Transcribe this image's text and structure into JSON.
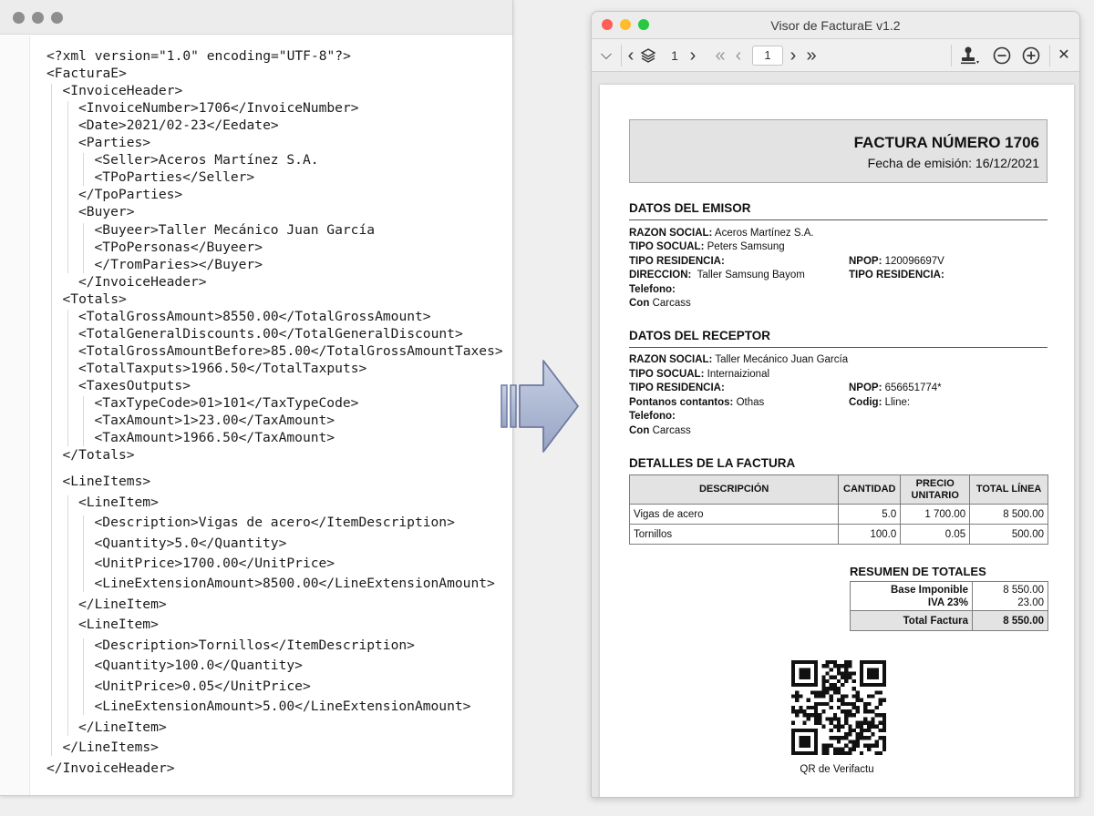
{
  "editor": {
    "lines": [
      {
        "text": "<?xml version=\"1.0\" encoding=\"UTF-8\"?>",
        "indent": 0
      },
      {
        "text": "<FacturaE>",
        "indent": 0
      },
      {
        "text": "<InvoiceHeader>",
        "indent": 1
      },
      {
        "text": "<InvoiceNumber>1706</InvoiceNumber>",
        "indent": 2
      },
      {
        "text": "<Date>2021/02-23</Eedate>",
        "indent": 2
      },
      {
        "text": "<Parties>",
        "indent": 2
      },
      {
        "text": "<Seller>Aceros Martínez S.A.",
        "indent": 3
      },
      {
        "text": "<TPoParties</Seller>",
        "indent": 3
      },
      {
        "text": "</TpoParties>",
        "indent": 2
      },
      {
        "text": "<Buyer>",
        "indent": 2
      },
      {
        "text": "<Buyeer>Taller Mecánico Juan García",
        "indent": 3
      },
      {
        "text": "<TPoPersonas</Buyeer>",
        "indent": 3
      },
      {
        "text": "</TromParies></Buyer>",
        "indent": 3
      },
      {
        "text": "</InvoiceHeader>",
        "indent": 2
      },
      {
        "text": "<Totals>",
        "indent": 1
      },
      {
        "text": "<TotalGrossAmount>8550.00</TotalGrossAmount>",
        "indent": 2
      },
      {
        "text": "<TotalGeneralDiscounts.00</TotalGeneralDiscount>",
        "indent": 2
      },
      {
        "text": "<TotalGrossAmountBefore>85.00</TotalGrossAmountTaxes>",
        "indent": 2
      },
      {
        "text": "<TotalTaxputs>1966.50</TotalTaxputs>",
        "indent": 2
      },
      {
        "text": "<TaxesOutputs>",
        "indent": 2
      },
      {
        "text": "<TaxTypeCode>01>101</TaxTypeCode>",
        "indent": 3
      },
      {
        "text": "<TaxAmount>1>23.00</TaxAmount>",
        "indent": 3
      },
      {
        "text": "<TaxAmount>1966.50</TaxAmount>",
        "indent": 3
      },
      {
        "text": "</Totals>",
        "indent": 1
      },
      {
        "text": "<LineItems>",
        "indent": 1
      },
      {
        "text": "<LineItem>",
        "indent": 2
      },
      {
        "text": "<Description>Vigas de acero</ItemDescription>",
        "indent": 3
      },
      {
        "text": "<Quantity>5.0</Quantity>",
        "indent": 3
      },
      {
        "text": "<UnitPrice>1700.00</UnitPrice>",
        "indent": 3
      },
      {
        "text": "<LineExtensionAmount>8500.00</LineExtensionAmount>",
        "indent": 3
      },
      {
        "text": "</LineItem>",
        "indent": 2
      },
      {
        "text": "<LineItem>",
        "indent": 2
      },
      {
        "text": "<Description>Tornillos</ItemDescription>",
        "indent": 3
      },
      {
        "text": "<Quantity>100.0</Quantity>",
        "indent": 3
      },
      {
        "text": "<UnitPrice>0.05</UnitPrice>",
        "indent": 3
      },
      {
        "text": "<LineExtensionAmount>5.00</LineExtensionAmount>",
        "indent": 3
      },
      {
        "text": "</LineItem>",
        "indent": 2
      },
      {
        "text": "</LineItems>",
        "indent": 1
      },
      {
        "text": "</InvoiceHeader>",
        "indent": 0
      }
    ]
  },
  "viewer": {
    "title": "Visor de FacturaE v1.2",
    "toolbar": {
      "chevron_down": "⌵",
      "prev": "‹",
      "next": "›",
      "layer_count": "1",
      "first": "«",
      "prev_page": "‹",
      "page_input": "1",
      "next_page": "›",
      "last": "»",
      "close": "✕"
    }
  },
  "invoice": {
    "title": "FACTURA NÚMERO 1706",
    "issue_date": "Fecha de emisión: 16/12/2021",
    "emisor": {
      "heading": "DATOS DEL EMISOR",
      "razon_label": "RAZON SOCIAL:",
      "razon_value": "Aceros Martínez S.A.",
      "tipo_social_label": "TIPO SOCUAL:",
      "tipo_social_value": "Peters Samsung",
      "tipo_res_label": "TIPO RESIDENCIA:",
      "npop_label": "NPOP:",
      "npop_value": "120096697V",
      "direccion_label": "DIRECCION:",
      "direccion_value": "Taller Samsung Bayom",
      "tipo_res2_label": "TIPO RESIDENCIA:",
      "telefono_label": "Telefono:",
      "con_label": "Con",
      "con_value": "Carcass"
    },
    "receptor": {
      "heading": "DATOS DEL RECEPTOR",
      "razon_label": "RAZON SOCIAL:",
      "razon_value": "Taller Mecánico Juan García",
      "tipo_social_label": "TIPO SOCUAL:",
      "tipo_social_value": "Internaizional",
      "tipo_res_label": "TIPO RESIDENCIA:",
      "npop_label": "NPOP:",
      "npop_value": "656651774*",
      "pontanos_label": "Pontanos contantos:",
      "pontanos_value": "Othas",
      "codig_label": "Codig:",
      "codig_value": "Lline:",
      "telefono_label": "Telefono:",
      "con_label": "Con",
      "con_value": "Carcass"
    },
    "detalles": {
      "heading": "DETALLES DE LA FACTURA",
      "columns": [
        "DESCRIPCIÓN",
        "CANTIDAD",
        "PRECIO UNITARIO",
        "TOTAL LÍNEA"
      ],
      "rows": [
        [
          "Vigas de acero",
          "5.0",
          "1 700.00",
          "8 500.00"
        ],
        [
          "Tornillos",
          "100.0",
          "0.05",
          "500.00"
        ]
      ]
    },
    "resumen": {
      "heading": "RESUMEN DE TOTALES",
      "base_label": "Base Imponible",
      "base_value": "8 550.00",
      "iva_label": "IVA 23%",
      "iva_value": "23.00",
      "total_label": "Total Factura",
      "total_value": "8 550.00"
    },
    "qr_caption": "QR de Verifactu"
  },
  "colors": {
    "xml_text": "#1c1c1c",
    "accent_red": "#fe5f57",
    "accent_yellow": "#febc2e",
    "accent_green": "#28c840",
    "arrow_fill": "#aeb9d4",
    "arrow_stroke": "#6d7aa0"
  }
}
